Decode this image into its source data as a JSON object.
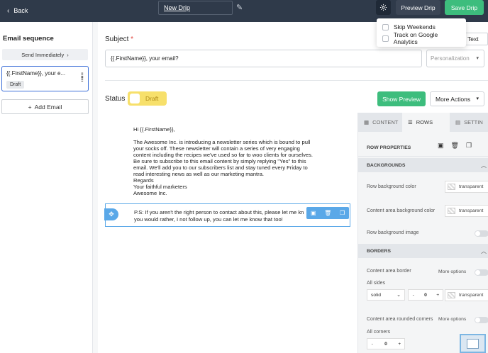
{
  "topbar": {
    "back_label": "Back",
    "drip_name": "New Drip",
    "preview_label": "Preview Drip",
    "save_label": "Save Drip",
    "colors": {
      "bar": "#2f3a4a",
      "save": "#3dbd7d"
    }
  },
  "settings_menu": {
    "options": [
      {
        "label": "Skip Weekends",
        "checked": false
      },
      {
        "label": "Track on Google Analytics",
        "checked": false
      }
    ]
  },
  "sidebar": {
    "title": "Email sequence",
    "send_timing": "Send Immediately",
    "email_card": {
      "title": "{{.FirstName}}, your e...",
      "badge": "Draft"
    },
    "add_email_label": "Add Email"
  },
  "editor": {
    "subject_label": "Subject",
    "required_mark": "*",
    "text_tab": "Text",
    "subject_value": "{{.FirstName}}, your email?",
    "personalization_placeholder": "Personalization",
    "status_label": "Status",
    "status_value": "Draft",
    "show_preview_label": "Show Preview",
    "more_actions_label": "More Actions"
  },
  "email_content": {
    "greeting": "Hi {{.FirstName}},",
    "body_lines": [
      "The Awesome Inc. is introducing a newsletter series which is bound to pull",
      "your socks off. These newsletter will contain a series of very engaging",
      "content including the recipes we've used so far to woo clients for ourselves.",
      "Be sure to subscribe to this email content by simply replying \"Yes\" to this",
      "email. We'll add you to our subscribers list and stay tuned every Friday to",
      "read interesting news as well as our marketing mantra."
    ],
    "regards": "Regards",
    "signoff_1": "Your faithful marketers",
    "signoff_2": "Awesome Inc.",
    "ps_line_1": "P.S: If you aren't the right person to contact about this, please let me kn",
    "ps_line_2": "you would rather, I not follow up, you can let me know that too!"
  },
  "right_panel": {
    "tabs": [
      "CONTENT",
      "ROWS",
      "SETTIN"
    ],
    "row_properties_label": "ROW PROPERTIES",
    "backgrounds_label": "BACKGROUNDS",
    "row_bg_label": "Row background color",
    "row_bg_value": "transparent",
    "content_bg_label": "Content area background color",
    "content_bg_value": "transparent",
    "row_bg_image_label": "Row background image",
    "borders_label": "BORDERS",
    "content_border_label": "Content area border",
    "more_options_label": "More options",
    "all_sides_label": "All sides",
    "border_style": "solid",
    "border_width": "0",
    "border_color": "transparent",
    "rounded_corners_label": "Content area rounded corners",
    "all_corners_label": "All corners",
    "corner_radius": "0",
    "minus": "-",
    "plus": "+"
  }
}
